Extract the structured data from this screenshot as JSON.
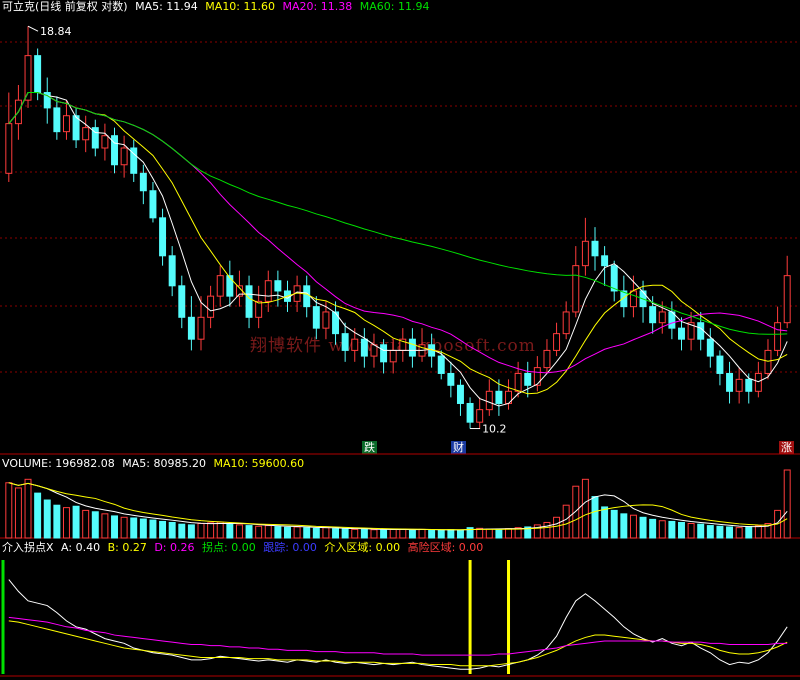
{
  "header": {
    "title": "可立克(日线 前复权 对数)",
    "ma5": "MA5: 11.94",
    "ma10": "MA10: 11.60",
    "ma20": "MA20: 11.38",
    "ma60": "MA60: 11.94"
  },
  "price_panel": {
    "high_label": "18.84",
    "low_label": "10.2",
    "markers": [
      "跌",
      "财",
      "涨"
    ]
  },
  "volume_header": {
    "volume": "VOLUME: 196982.08",
    "ma5": "MA5: 80985.20",
    "ma10": "MA10: 59600.60"
  },
  "indicator_header": {
    "name": "介入拐点X",
    "a": "A: 0.40",
    "b": "B: 0.27",
    "d": "D: 0.26",
    "turn": "拐点: 0.00",
    "trace": "跟踪: 0.00",
    "entry": "介入区域: 0.00",
    "risk": "高险区域: 0.00"
  },
  "watermark": "翔博软件 www.xiangbosoft.com",
  "colors": {
    "up": "#ff3c3c",
    "down": "#54fcfc",
    "ma5": "#ffffff",
    "ma10": "#ffff00",
    "ma20": "#ff00ff",
    "ma60": "#00e000",
    "grid": "#8a0000"
  },
  "chart_data": {
    "type": "candlestick",
    "price_scale": "log",
    "price_range": [
      9.8,
      19.2
    ],
    "candles": [
      [
        15.0,
        16.2,
        17.0,
        14.8
      ],
      [
        16.2,
        16.8,
        17.2,
        15.8
      ],
      [
        16.8,
        18.0,
        18.84,
        16.6
      ],
      [
        18.0,
        17.0,
        18.2,
        16.8
      ],
      [
        17.0,
        16.6,
        17.4,
        16.2
      ],
      [
        16.6,
        16.0,
        16.9,
        15.8
      ],
      [
        16.0,
        16.4,
        16.8,
        15.8
      ],
      [
        16.4,
        15.8,
        16.6,
        15.6
      ],
      [
        15.8,
        16.1,
        16.4,
        15.5
      ],
      [
        16.1,
        15.6,
        16.3,
        15.4
      ],
      [
        15.6,
        15.9,
        16.2,
        15.3
      ],
      [
        15.9,
        15.2,
        16.1,
        15.0
      ],
      [
        15.2,
        15.6,
        15.9,
        14.9
      ],
      [
        15.6,
        15.0,
        15.8,
        14.8
      ],
      [
        15.0,
        14.6,
        15.2,
        14.3
      ],
      [
        14.6,
        14.0,
        14.8,
        13.9
      ],
      [
        14.0,
        13.2,
        14.2,
        13.0
      ],
      [
        13.2,
        12.6,
        13.4,
        12.4
      ],
      [
        12.6,
        12.0,
        12.8,
        11.8
      ],
      [
        12.0,
        11.6,
        12.4,
        11.4
      ],
      [
        11.6,
        12.0,
        12.4,
        11.4
      ],
      [
        12.0,
        12.4,
        12.6,
        11.8
      ],
      [
        12.4,
        12.8,
        13.0,
        12.2
      ],
      [
        12.8,
        12.4,
        13.1,
        12.2
      ],
      [
        12.4,
        12.6,
        12.9,
        12.2
      ],
      [
        12.6,
        12.0,
        12.8,
        11.8
      ],
      [
        12.0,
        12.3,
        12.6,
        11.8
      ],
      [
        12.3,
        12.7,
        12.9,
        12.1
      ],
      [
        12.7,
        12.5,
        12.9,
        12.2
      ],
      [
        12.5,
        12.3,
        12.7,
        12.1
      ],
      [
        12.3,
        12.6,
        12.8,
        12.1
      ],
      [
        12.6,
        12.2,
        12.8,
        12.0
      ],
      [
        12.2,
        11.8,
        12.4,
        11.6
      ],
      [
        11.8,
        12.1,
        12.3,
        11.6
      ],
      [
        12.1,
        11.7,
        12.3,
        11.5
      ],
      [
        11.7,
        11.4,
        11.9,
        11.2
      ],
      [
        11.4,
        11.6,
        11.8,
        11.2
      ],
      [
        11.6,
        11.3,
        11.8,
        11.1
      ],
      [
        11.3,
        11.5,
        11.7,
        11.1
      ],
      [
        11.5,
        11.2,
        11.6,
        11.0
      ],
      [
        11.2,
        11.4,
        11.6,
        11.0
      ],
      [
        11.4,
        11.6,
        11.8,
        11.2
      ],
      [
        11.6,
        11.3,
        11.8,
        11.1
      ],
      [
        11.3,
        11.5,
        11.8,
        11.2
      ],
      [
        11.5,
        11.3,
        11.7,
        11.1
      ],
      [
        11.3,
        11.0,
        11.4,
        10.9
      ],
      [
        11.0,
        10.8,
        11.2,
        10.6
      ],
      [
        10.8,
        10.5,
        10.9,
        10.3
      ],
      [
        10.5,
        10.2,
        10.6,
        10.1
      ],
      [
        10.2,
        10.4,
        10.6,
        10.1
      ],
      [
        10.4,
        10.7,
        10.9,
        10.3
      ],
      [
        10.7,
        10.5,
        10.9,
        10.3
      ],
      [
        10.5,
        10.7,
        10.9,
        10.4
      ],
      [
        10.7,
        11.0,
        11.2,
        10.6
      ],
      [
        11.0,
        10.8,
        11.2,
        10.6
      ],
      [
        10.8,
        11.1,
        11.3,
        10.7
      ],
      [
        11.1,
        11.4,
        11.6,
        11.0
      ],
      [
        11.4,
        11.7,
        11.9,
        11.3
      ],
      [
        11.7,
        12.1,
        12.3,
        11.6
      ],
      [
        12.1,
        13.0,
        13.4,
        12.0
      ],
      [
        13.0,
        13.5,
        14.0,
        12.8
      ],
      [
        13.5,
        13.2,
        13.8,
        12.9
      ],
      [
        13.2,
        13.0,
        13.4,
        12.6
      ],
      [
        13.0,
        12.5,
        13.1,
        12.3
      ],
      [
        12.5,
        12.2,
        12.8,
        12.0
      ],
      [
        12.2,
        12.5,
        12.8,
        12.0
      ],
      [
        12.5,
        12.2,
        12.7,
        11.9
      ],
      [
        12.2,
        11.9,
        12.4,
        11.7
      ],
      [
        11.9,
        12.1,
        12.3,
        11.7
      ],
      [
        12.1,
        11.8,
        12.3,
        11.6
      ],
      [
        11.8,
        11.6,
        12.0,
        11.4
      ],
      [
        11.6,
        11.9,
        12.1,
        11.4
      ],
      [
        11.9,
        11.6,
        12.1,
        11.4
      ],
      [
        11.6,
        11.3,
        11.8,
        11.1
      ],
      [
        11.3,
        11.0,
        11.4,
        10.8
      ],
      [
        11.0,
        10.7,
        11.2,
        10.5
      ],
      [
        10.7,
        10.9,
        11.1,
        10.5
      ],
      [
        10.9,
        10.7,
        11.0,
        10.5
      ],
      [
        10.7,
        11.0,
        11.2,
        10.6
      ],
      [
        11.0,
        11.4,
        11.6,
        10.9
      ],
      [
        11.4,
        11.9,
        12.2,
        11.3
      ],
      [
        11.9,
        12.8,
        13.2,
        11.8
      ]
    ],
    "volume": [
      160000,
      145000,
      170000,
      130000,
      110000,
      95000,
      88000,
      92000,
      80000,
      76000,
      70000,
      64000,
      60000,
      58000,
      55000,
      52000,
      48000,
      45000,
      40000,
      38000,
      42000,
      44000,
      46000,
      40000,
      38000,
      36000,
      34000,
      36000,
      33000,
      31000,
      32000,
      30000,
      28000,
      30000,
      27000,
      26000,
      25000,
      27000,
      24000,
      23000,
      25000,
      26000,
      24000,
      25000,
      23000,
      22000,
      24000,
      23000,
      30000,
      28000,
      26000,
      25000,
      27000,
      30000,
      32000,
      38000,
      45000,
      60000,
      95000,
      150000,
      170000,
      120000,
      90000,
      80000,
      70000,
      66000,
      60000,
      54000,
      50000,
      48000,
      45000,
      42000,
      40000,
      36000,
      34000,
      32000,
      30000,
      33000,
      35000,
      42000,
      80000,
      196982
    ],
    "indicator": {
      "series": [
        {
          "name": "A",
          "color": "#ffffff",
          "values": [
            0.8,
            0.7,
            0.62,
            0.6,
            0.58,
            0.52,
            0.45,
            0.4,
            0.38,
            0.34,
            0.3,
            0.28,
            0.26,
            0.22,
            0.2,
            0.18,
            0.17,
            0.16,
            0.14,
            0.12,
            0.12,
            0.13,
            0.15,
            0.14,
            0.13,
            0.12,
            0.11,
            0.12,
            0.11,
            0.1,
            0.12,
            0.11,
            0.1,
            0.12,
            0.1,
            0.09,
            0.1,
            0.09,
            0.08,
            0.09,
            0.08,
            0.09,
            0.1,
            0.08,
            0.07,
            0.06,
            0.05,
            0.04,
            0.04,
            0.05,
            0.07,
            0.06,
            0.08,
            0.1,
            0.12,
            0.16,
            0.22,
            0.32,
            0.48,
            0.62,
            0.68,
            0.62,
            0.55,
            0.48,
            0.4,
            0.34,
            0.3,
            0.27,
            0.3,
            0.26,
            0.24,
            0.27,
            0.22,
            0.18,
            0.12,
            0.08,
            0.1,
            0.09,
            0.12,
            0.18,
            0.28,
            0.4
          ]
        },
        {
          "name": "B",
          "color": "#ffff00",
          "values": [
            0.45,
            0.44,
            0.42,
            0.4,
            0.38,
            0.36,
            0.34,
            0.32,
            0.3,
            0.28,
            0.26,
            0.24,
            0.22,
            0.21,
            0.2,
            0.19,
            0.18,
            0.17,
            0.16,
            0.15,
            0.14,
            0.14,
            0.14,
            0.14,
            0.14,
            0.13,
            0.13,
            0.13,
            0.12,
            0.12,
            0.12,
            0.12,
            0.11,
            0.11,
            0.11,
            0.1,
            0.1,
            0.1,
            0.1,
            0.09,
            0.09,
            0.09,
            0.09,
            0.09,
            0.08,
            0.08,
            0.08,
            0.07,
            0.07,
            0.07,
            0.07,
            0.08,
            0.09,
            0.1,
            0.12,
            0.14,
            0.17,
            0.2,
            0.24,
            0.28,
            0.31,
            0.33,
            0.33,
            0.32,
            0.31,
            0.3,
            0.29,
            0.28,
            0.28,
            0.27,
            0.26,
            0.26,
            0.25,
            0.23,
            0.2,
            0.18,
            0.17,
            0.17,
            0.18,
            0.2,
            0.23,
            0.27
          ]
        },
        {
          "name": "D",
          "color": "#ff00ff",
          "values": [
            0.48,
            0.47,
            0.46,
            0.45,
            0.44,
            0.42,
            0.4,
            0.39,
            0.37,
            0.36,
            0.35,
            0.33,
            0.32,
            0.31,
            0.3,
            0.29,
            0.28,
            0.27,
            0.26,
            0.25,
            0.25,
            0.24,
            0.24,
            0.23,
            0.23,
            0.22,
            0.22,
            0.21,
            0.21,
            0.2,
            0.2,
            0.2,
            0.19,
            0.19,
            0.19,
            0.18,
            0.18,
            0.18,
            0.18,
            0.17,
            0.17,
            0.17,
            0.17,
            0.16,
            0.16,
            0.16,
            0.16,
            0.16,
            0.16,
            0.16,
            0.16,
            0.17,
            0.17,
            0.18,
            0.19,
            0.2,
            0.21,
            0.22,
            0.24,
            0.25,
            0.26,
            0.27,
            0.28,
            0.28,
            0.28,
            0.28,
            0.28,
            0.28,
            0.28,
            0.27,
            0.27,
            0.27,
            0.27,
            0.26,
            0.26,
            0.25,
            0.25,
            0.25,
            0.25,
            0.25,
            0.26,
            0.26
          ]
        }
      ],
      "range": [
        0,
        1
      ],
      "signal_bars": [
        0,
        48,
        52
      ]
    }
  }
}
